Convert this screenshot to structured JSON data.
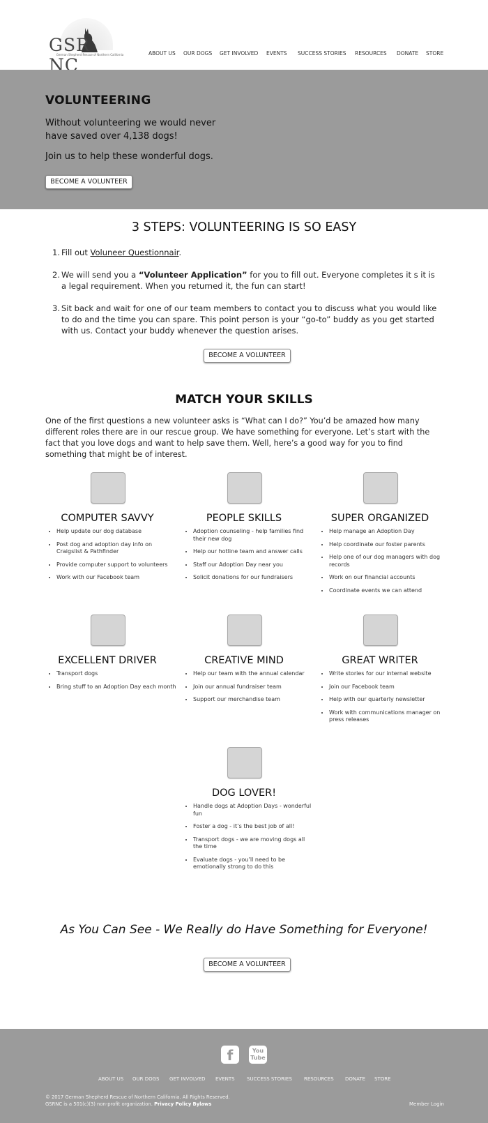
{
  "brand": {
    "logo_text": "GSR NC",
    "logo_text_left": "GSR",
    "logo_text_right": "NC",
    "tagline": "German Shepherd Rescue of Northern California"
  },
  "nav": {
    "items": [
      {
        "label": "ABOUT US"
      },
      {
        "label": "OUR DOGS"
      },
      {
        "label": "GET INVOLVED"
      },
      {
        "label": "EVENTS"
      },
      {
        "label": "SUCCESS STORIES"
      },
      {
        "label": "RESOURCES"
      },
      {
        "label": "DONATE"
      },
      {
        "label": "STORE"
      }
    ]
  },
  "hero": {
    "title": "VOLUNTEERING",
    "line1": "Without volunteering we would never have saved over 4,138 dogs!",
    "line2": "Join us to help these wonderful dogs.",
    "button": "BECOME A VOLUNTEER"
  },
  "steps": {
    "title": "3 STEPS: VOLUNTEERING IS SO EASY",
    "step1": {
      "num": "1.",
      "pre": "Fill out ",
      "link": "Voluneer Questionnair",
      "post": "."
    },
    "step2": {
      "num": "2.",
      "pre": "We will send you a ",
      "bold": "“Volunteer Application”",
      "post": " for you to fill out. Everyone completes it s it is a legal requirement. When you returned it, the fun can start!"
    },
    "step3": {
      "num": "3.",
      "text": "Sit back and wait for one of our team members to contact you to discuss what you would like to do and the time you can spare. This point person is your “go-to” buddy as you get started with us. Contact your buddy whenever the question arises."
    },
    "button": "BECOME A VOLUNTEER"
  },
  "skills": {
    "title": "MATCH YOUR SKILLS",
    "intro": "One of the first questions a new volunteer asks is “What can I do?” You’d be amazed how many different roles there are in our rescue group. We have something for everyone. Let’s start with the fact that you love dogs and want to help save them. Well, here’s a good way for you to find something that might be of interest.",
    "items": [
      {
        "name": "COMPUTER SAVVY",
        "tasks": [
          "Help update our dog database",
          "Post dog and adoption day info on Craigslist & Pathfinder",
          "Provide computer support to volunteers",
          "Work with our Facebook team"
        ]
      },
      {
        "name": "PEOPLE SKILLS",
        "tasks": [
          "Adoption counseling - help families find their new dog",
          "Help our hotline team and answer calls",
          "Staff our Adoption Day near you",
          "Solicit donations for our fundraisers"
        ]
      },
      {
        "name": "SUPER ORGANIZED",
        "tasks": [
          "Help manage an Adoption Day",
          "Help coordinate our foster parents",
          "Help one of our dog managers with dog records",
          "Work on our financial accounts",
          "Coordinate events we can attend"
        ]
      },
      {
        "name": "EXCELLENT DRIVER",
        "tasks": [
          "Transport dogs",
          "Bring stuff to an Adoption Day each month"
        ]
      },
      {
        "name": "CREATIVE MIND",
        "tasks": [
          "Help our team with the annual calendar",
          "Join our annual fundraiser team",
          "Support our merchandise team"
        ]
      },
      {
        "name": "GREAT WRITER",
        "tasks": [
          "Write stories for our internal website",
          "Join our Facebook team",
          "Help with our quarterly newsletter",
          "Work with communications manager on press releases"
        ]
      },
      {
        "name": "DOG LOVER!",
        "tasks": [
          "Handle dogs at Adoption Days - wonderful fun",
          "Foster a dog - it’s the best job of all!",
          "Transport dogs - we are moving dogs all the time",
          "Evaluate dogs - you’ll need to be emotionally strong to do this"
        ]
      }
    ]
  },
  "closing": {
    "text": "As You Can See - We Really do Have Something for Everyone!",
    "button": "BECOME A VOLUNTEER"
  },
  "footer": {
    "social": {
      "facebook": "f",
      "youtube_top": "You",
      "youtube_bottom": "Tube"
    },
    "nav": [
      {
        "label": "ABOUT US"
      },
      {
        "label": "OUR DOGS"
      },
      {
        "label": "GET INVOLVED"
      },
      {
        "label": "EVENTS"
      },
      {
        "label": "SUCCESS STORIES"
      },
      {
        "label": "RESOURCES"
      },
      {
        "label": "DONATE"
      },
      {
        "label": "STORE"
      }
    ],
    "copyright": "© 2017 German Shepherd Rescue of Northern California. All Rights Reserved.",
    "nonprofit": "GSRNC is a 501(c)(3) non-profit organization.",
    "privacy": "Privacy Policy",
    "bylaws": "Bylaws",
    "member_login": "Member Login"
  },
  "colors": {
    "band": "#9b9b9b",
    "placeholder": "#d5d5d5"
  }
}
